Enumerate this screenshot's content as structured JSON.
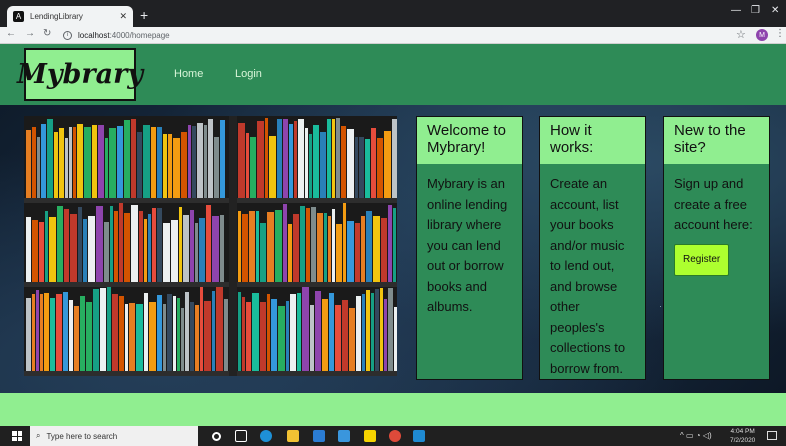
{
  "browser": {
    "tab_title": "LendingLibrary",
    "tab_close": "✕",
    "new_tab": "+",
    "url_host": "localhost",
    "url_path": ":4000/homepage",
    "profile_initial": "M",
    "controls": {
      "minimize": "—",
      "maximize": "❐",
      "close": "✕"
    }
  },
  "site": {
    "logo": "Mybrary",
    "nav": [
      {
        "label": "Home"
      },
      {
        "label": "Login"
      }
    ],
    "cards": [
      {
        "heading": "Welcome to Mybrary!",
        "body": "Mybrary is an online lending library where you can lend out or borrow books and albums."
      },
      {
        "heading": "How it works:",
        "body": "Create an account, list your books and/or music to lend out, and browse other peoples's collections to borrow from."
      },
      {
        "heading": "New to the site?",
        "body": "Sign up and create a free account here:",
        "button": "Register"
      }
    ],
    "colors": {
      "header": "#2e8b57",
      "accent": "#90ee90",
      "button": "#adff2f"
    }
  },
  "taskbar": {
    "search_placeholder": "Type here to search",
    "time": "4:04 PM",
    "date": "7/2/2020"
  }
}
